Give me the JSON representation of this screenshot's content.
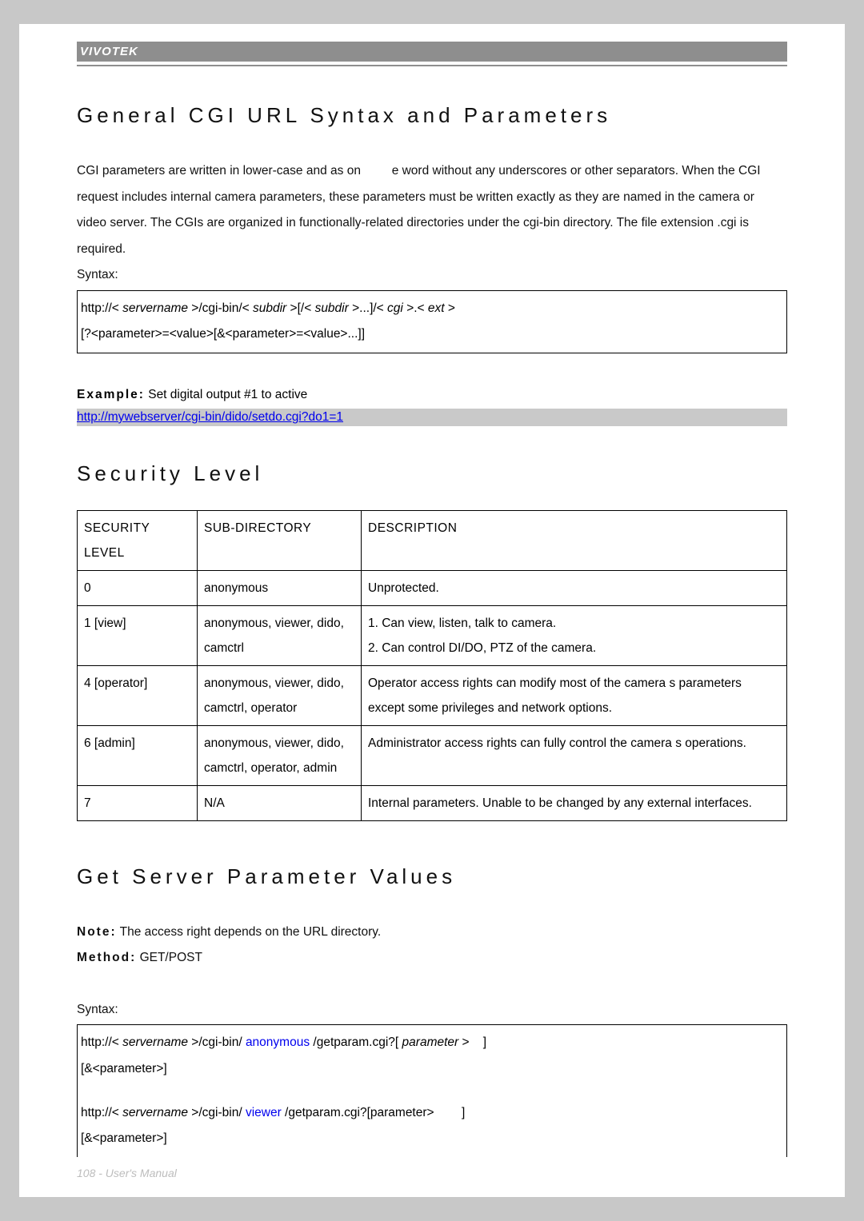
{
  "brand": "VIVOTEK",
  "sections": {
    "s1": {
      "title": "General CGI URL Syntax and Parameters",
      "intro": "CGI parameters are written in lower-case and as on         e word without any underscores or other separators. When the CGI request includes internal camera parameters, these parameters must be written exactly as they are named in the camera or video server. The CGIs are organized in functionally-related directories under the cgi-bin directory. The file extension .cgi is required.",
      "syntax_label": "Syntax:",
      "syntax_line1_a": "http://<",
      "syntax_line1_b": "servername",
      "syntax_line1_c": ">/cgi-bin/<",
      "syntax_line1_d": "subdir",
      "syntax_line1_e": ">[/<",
      "syntax_line1_f": "subdir",
      "syntax_line1_g": ">...]/<",
      "syntax_line1_h": "cgi",
      "syntax_line1_i": ">.<",
      "syntax_line1_j": "ext",
      "syntax_line1_k": ">",
      "syntax_line2": "[?<parameter>=<value>[&<parameter>=<value>...]]",
      "example_label": "Example:",
      "example_text": " Set digital output #1 to active",
      "example_url": "http://mywebserver/cgi-bin/dido/setdo.cgi?do1=1"
    },
    "s2": {
      "title": "Security Level",
      "headers": {
        "c1": "SECURITY LEVEL",
        "c2": "SUB-DIRECTORY",
        "c3": "DESCRIPTION"
      },
      "rows": [
        {
          "level": "0",
          "subdir": "anonymous",
          "desc": "Unprotected."
        },
        {
          "level": "1 [view]",
          "subdir": "anonymous, viewer, dido, camctrl",
          "desc": "1. Can view, listen, talk to camera.\n2. Can control DI/DO, PTZ of the camera."
        },
        {
          "level": "4 [operator]",
          "subdir": "anonymous, viewer, dido, camctrl, operator",
          "desc": "Operator access rights can modify most of the camera s parameters except some privileges and network options."
        },
        {
          "level": "6 [admin]",
          "subdir": "anonymous, viewer, dido, camctrl, operator, admin",
          "desc": "Administrator access rights can fully control the camera s operations."
        },
        {
          "level": "7",
          "subdir": "N/A",
          "desc": "Internal parameters. Unable to be changed by any external interfaces."
        }
      ]
    },
    "s3": {
      "title": "Get Server Parameter Values",
      "note_label": "Note:",
      "note_text": " The access right depends on the URL directory.",
      "method_label": "Method:",
      "method_text": " GET/POST",
      "syntax_label": "Syntax:",
      "block1": {
        "a": "http://<",
        "b": "servername",
        "c": ">/cgi-bin/",
        "d": "anonymous",
        "e": "/getparam.cgi?[",
        "f": "parameter",
        "g": ">    ]",
        "line2": "[&<parameter>]"
      },
      "block2": {
        "a": "http://<",
        "b": "servername",
        "c": ">/cgi-bin/",
        "d": "viewer",
        "e": "/getparam.cgi?[parameter>        ]",
        "line2": "[&<parameter>]"
      }
    }
  },
  "page_number": "108 - User's Manual"
}
